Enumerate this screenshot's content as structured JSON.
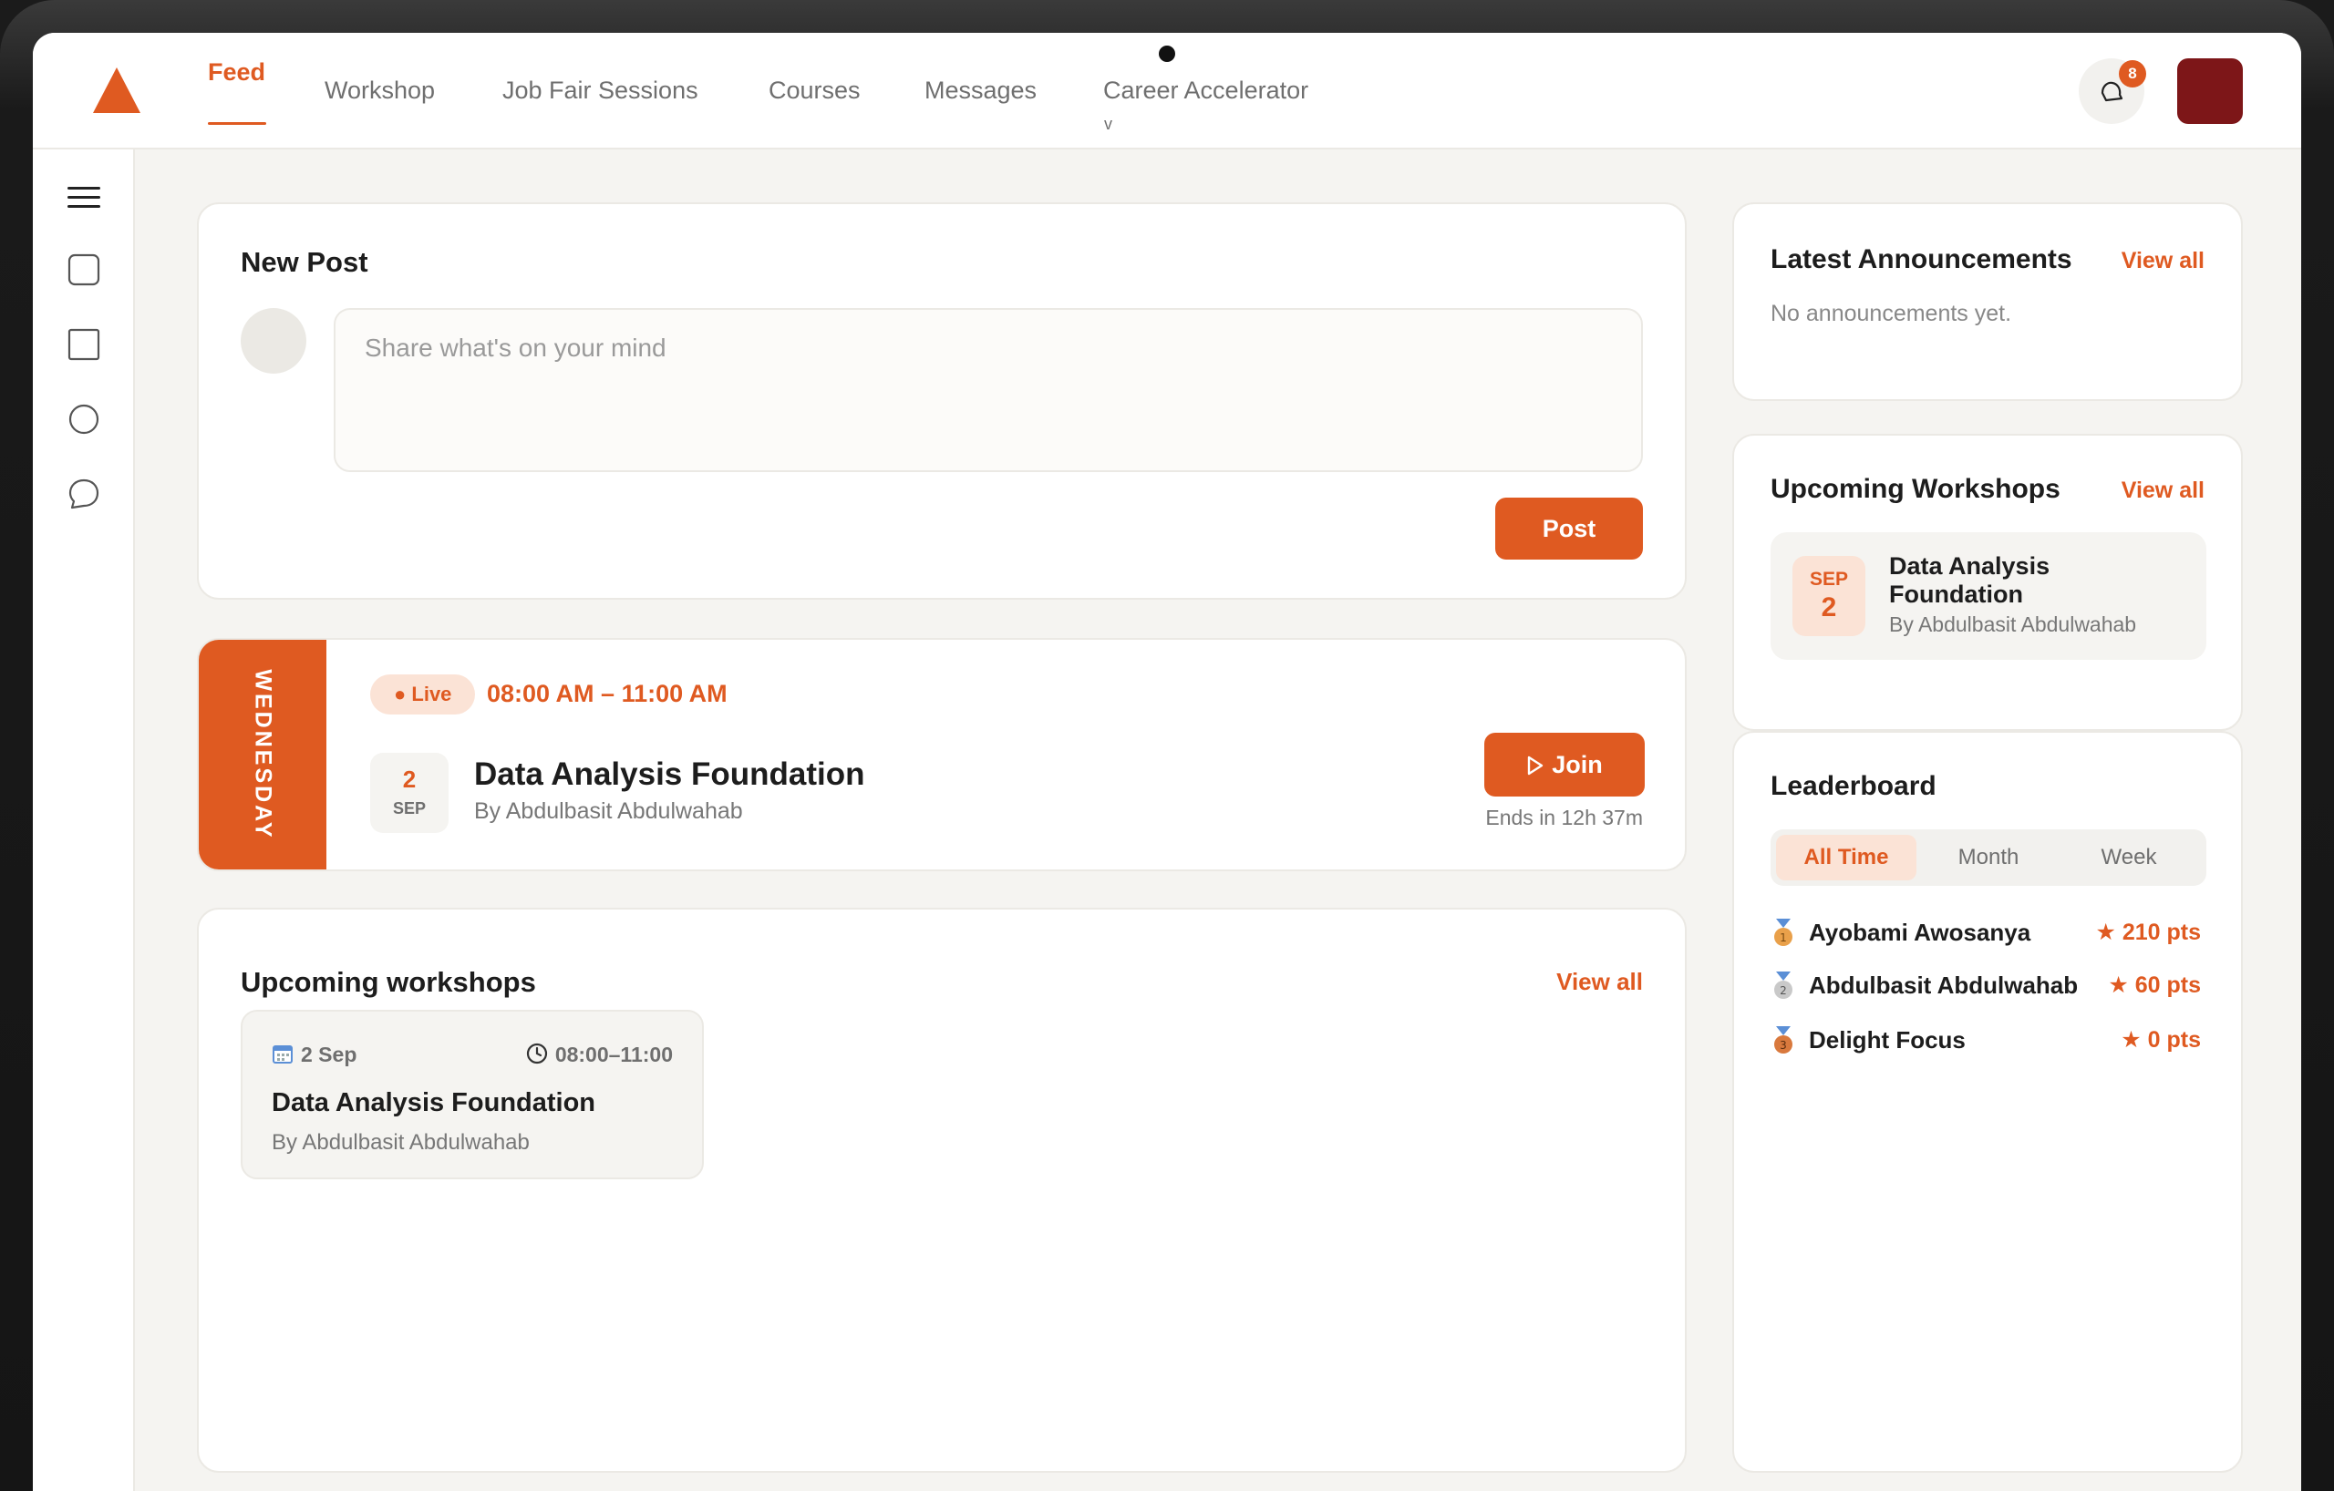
{
  "nav": {
    "items": [
      {
        "label": "Feed",
        "active": true
      },
      {
        "label": "Workshop"
      },
      {
        "label": "Job Fair Sessions"
      },
      {
        "label": "Courses"
      },
      {
        "label": "Messages"
      },
      {
        "label": "Career Accelerator"
      }
    ],
    "caret": "v",
    "notification_count": "8"
  },
  "colors": {
    "accent": "#df5a21",
    "avatar": "#7d1618"
  },
  "new_post": {
    "title": "New Post",
    "placeholder": "Share what's on your mind",
    "button": "Post"
  },
  "live_session": {
    "day": "WEDNESDAY",
    "status": "● Live",
    "time": "08:00 AM – 11:00 AM",
    "date_day": "2",
    "date_month": "SEP",
    "title": "Data Analysis Foundation",
    "by": "By Abdulbasit Abdulwahab",
    "join": "Join",
    "ends": "Ends in 12h 37m"
  },
  "upcoming_workshops": {
    "title": "Upcoming workshops",
    "view_all": "View all",
    "items": [
      {
        "date": "2 Sep",
        "time": "08:00–11:00",
        "title": "Data Analysis Foundation",
        "by": "By Abdulbasit Abdulwahab"
      }
    ]
  },
  "announcements": {
    "title": "Latest Announcements",
    "view_all": "View all",
    "empty": "No announcements yet."
  },
  "side_workshops": {
    "title": "Upcoming Workshops",
    "view_all": "View all",
    "items": [
      {
        "month": "SEP",
        "day": "2",
        "title": "Data Analysis Foundation",
        "by": "By Abdulbasit Abdulwahab"
      }
    ]
  },
  "leaderboard": {
    "title": "Leaderboard",
    "tabs": [
      "All Time",
      "Month",
      "Week"
    ],
    "active_tab": "All Time",
    "rows": [
      {
        "rank": "1",
        "name": "Ayobami Awosanya",
        "points": "★ 210 pts"
      },
      {
        "rank": "2",
        "name": "Abdulbasit Abdulwahab",
        "points": "★ 60 pts"
      },
      {
        "rank": "3",
        "name": "Delight Focus",
        "points": "★ 0 pts"
      }
    ]
  }
}
